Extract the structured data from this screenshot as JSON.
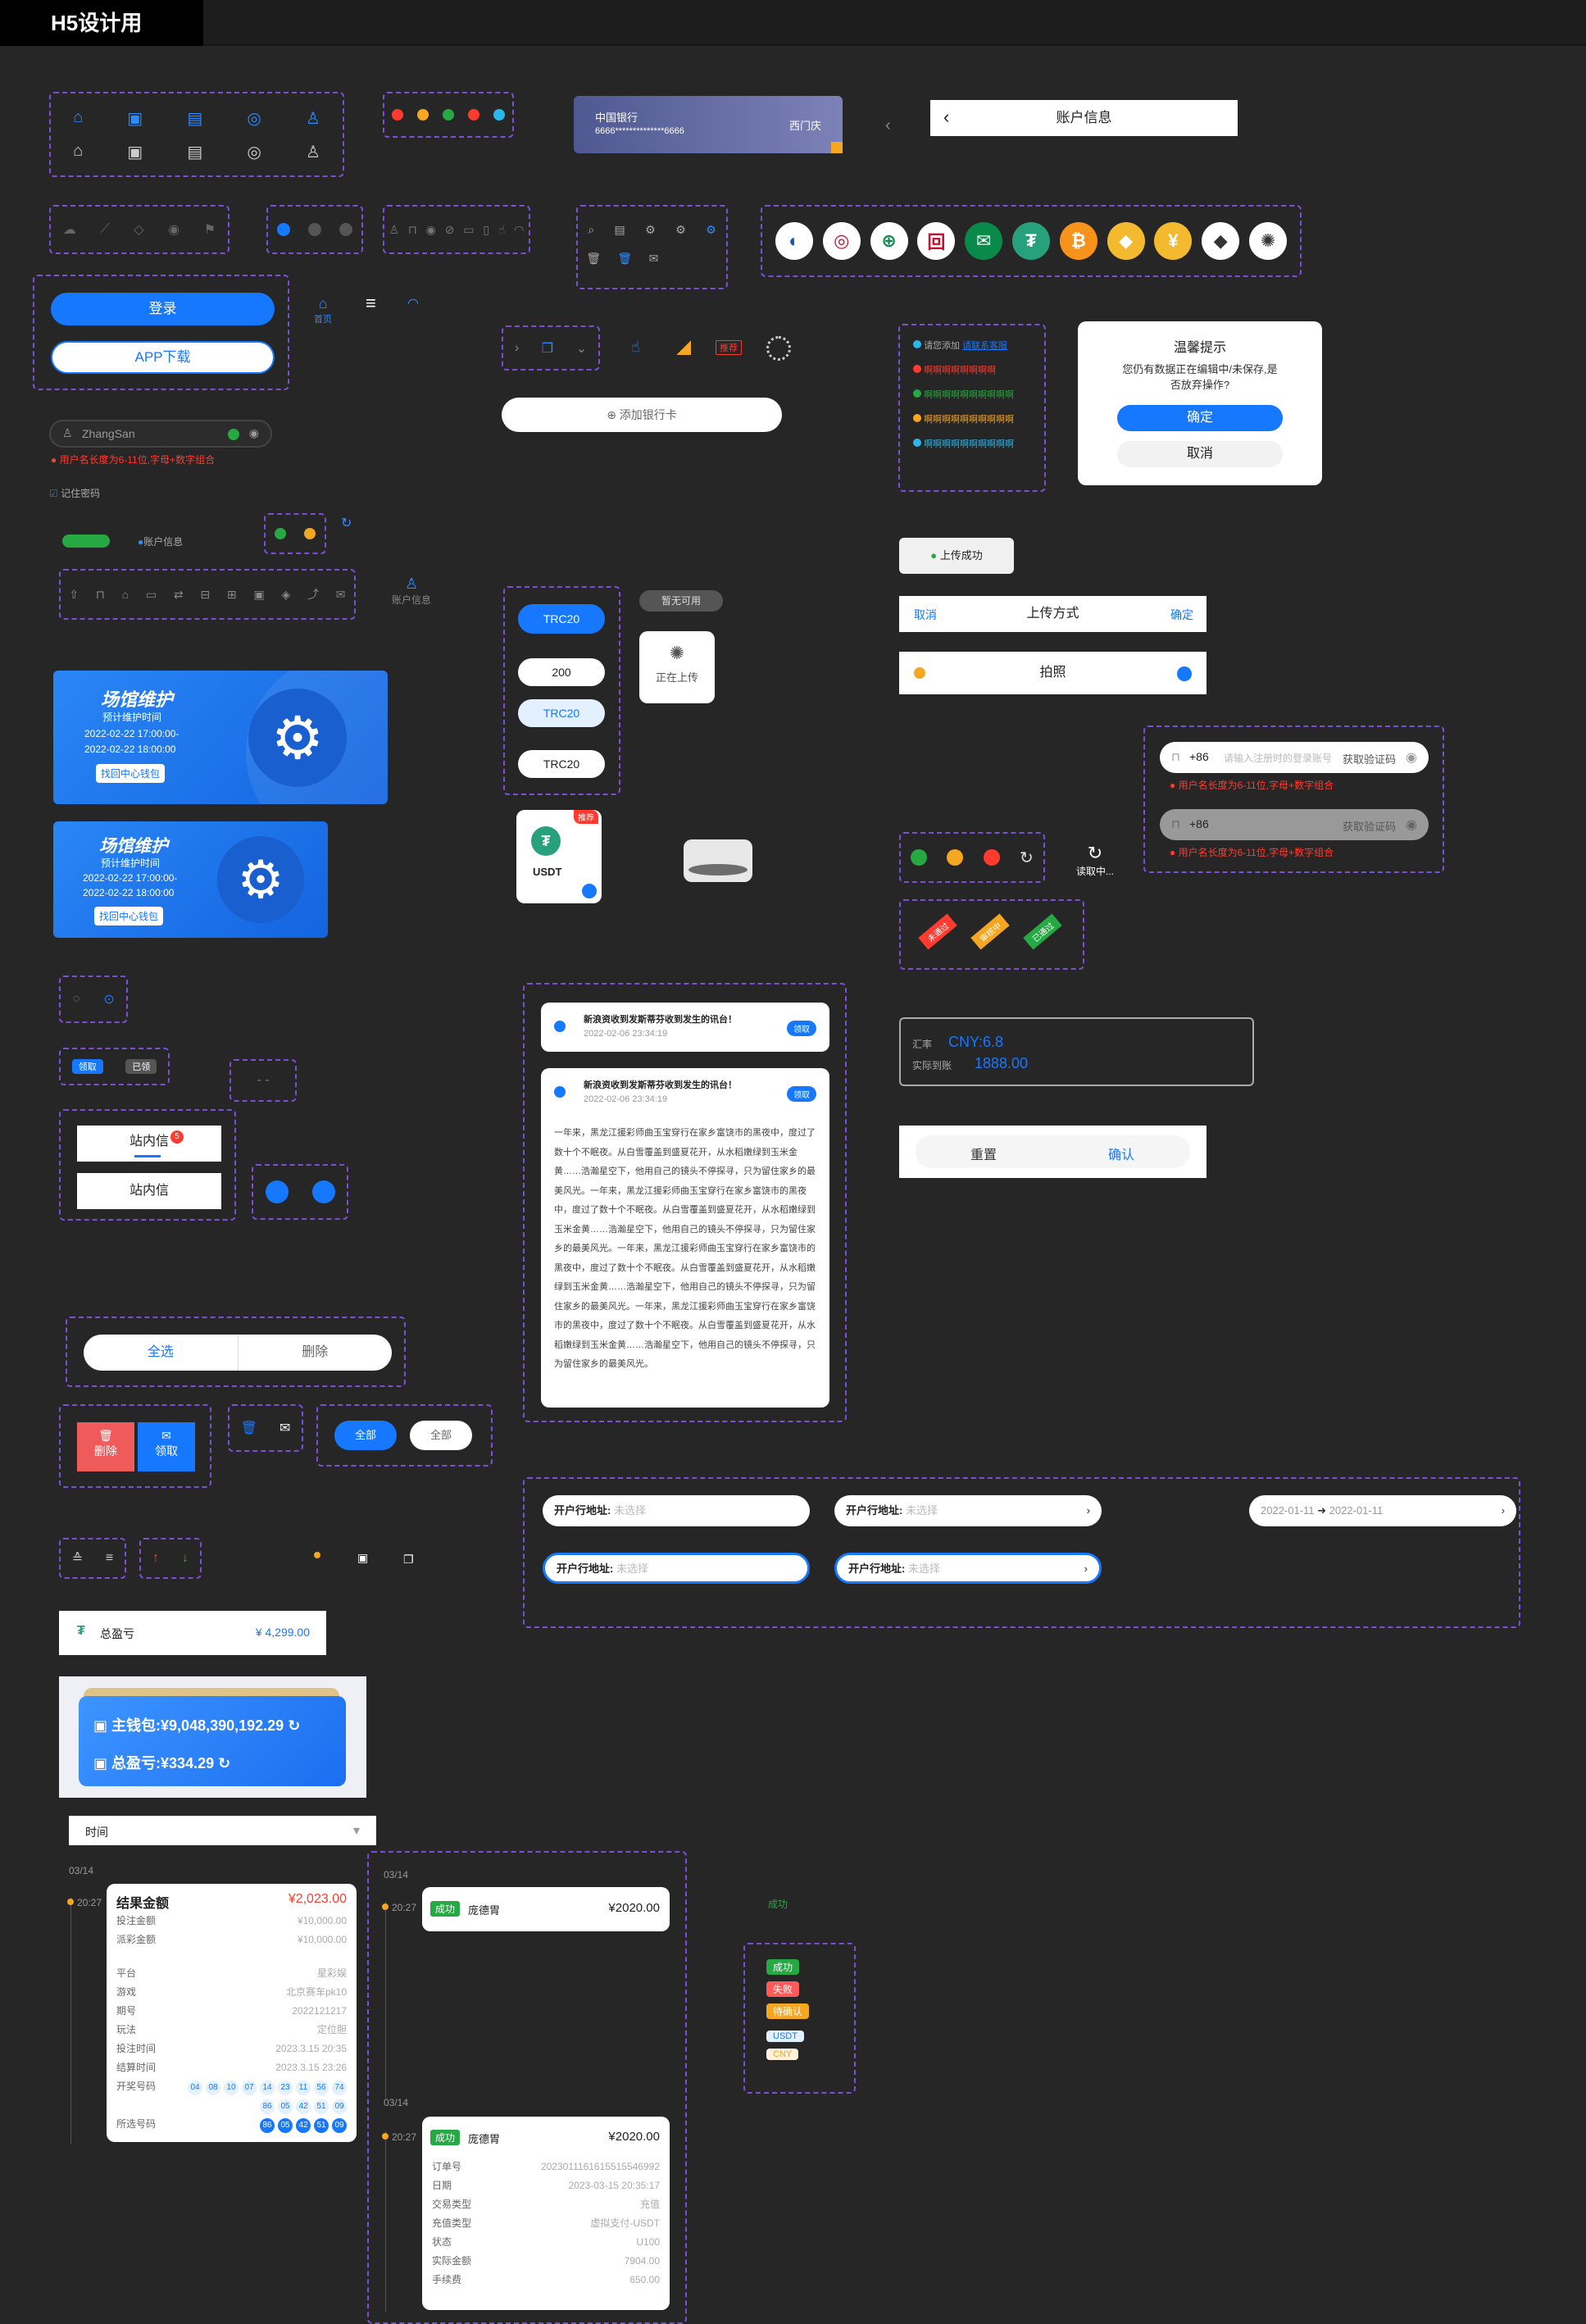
{
  "header": {
    "title": "H5设计用"
  },
  "bank_card": {
    "bank": "中国银行",
    "number": "6666**************6666",
    "holder": "西门庆"
  },
  "nav": {
    "title": "账户信息"
  },
  "login": {
    "login_label": "登录",
    "download_label": "APP下载",
    "home_label": "首页",
    "username": "ZhangSan",
    "error": "用户名长度为6-11位,字母+数字组合",
    "remember": "记住密码"
  },
  "account_info": {
    "label": "账户信息"
  },
  "chips": {
    "trc_selected": "TRC20",
    "amount": "200",
    "trc_light": "TRC20",
    "trc_plain": "TRC20",
    "unavailable": "暂无可用",
    "uploading": "正在上传"
  },
  "add_bank": {
    "label": "添加银行卡"
  },
  "recommend": "推荐",
  "usdt": {
    "label": "USDT",
    "badge": "推荐"
  },
  "notice_list": {
    "first_prefix": "请您添加",
    "first_link": "请联系客服",
    "items": [
      "啊啊啊啊啊啊啊啊",
      "啊啊啊啊啊啊啊啊啊啊",
      "啊啊啊啊啊啊啊啊啊啊",
      "啊啊啊啊啊啊啊啊啊啊"
    ]
  },
  "dialog": {
    "title": "温馨提示",
    "message": "您仍有数据正在编辑中/未保存,是否放弃操作?",
    "confirm": "确定",
    "cancel": "取消"
  },
  "upload_success": "上传成功",
  "upload_method": {
    "cancel": "取消",
    "title": "上传方式",
    "confirm": "确定",
    "option": "拍照"
  },
  "phone_form": {
    "code": "+86",
    "placeholder": "请输入注册时的登录账号",
    "get_code": "获取验证码",
    "error": "用户名长度为6-11位,字母+数字组合"
  },
  "reading": "读取中...",
  "ribbons": [
    "未通过",
    "审核中",
    "已通过"
  ],
  "rate": {
    "label1": "汇率",
    "value1": "CNY:6.8",
    "label2": "实际到账",
    "value2": "1888.00"
  },
  "reset_confirm": {
    "reset": "重置",
    "confirm": "确认"
  },
  "maintenance": {
    "title": "场馆维护",
    "sub": "预计维护时间",
    "from": "2022-02-22 17:00:00-",
    "to": "2022-02-22 18:00:00",
    "button": "找回中心钱包"
  },
  "claim_tags": {
    "claim": "领取",
    "claimed": "已领"
  },
  "mail": {
    "label": "站内信",
    "badge": "5"
  },
  "messages": {
    "title": "新浪资收到发斯蒂芬收到发生的讯台！",
    "time": "2022-02-06  23:34:19",
    "claim": "领取",
    "body": "一年来，黑龙江援彩师曲玉宝穿行在家乡富饶市的黑夜中，度过了数十个不眠夜。从白雪覆盖到盛夏花开，从水稻嫩绿到玉米金黄……浩瀚星空下，他用自己的镜头不停探寻，只为留住家乡的最美风光。一年来，黑龙江援彩师曲玉宝穿行在家乡富饶市的黑夜中，度过了数十个不眠夜。从白雪覆盖到盛夏花开，从水稻嫩绿到玉米金黄……浩瀚星空下，他用自己的镜头不停探寻，只为留住家乡的最美风光。一年来，黑龙江援彩师曲玉宝穿行在家乡富饶市的黑夜中，度过了数十个不眠夜。从白雪覆盖到盛夏花开，从水稻嫩绿到玉米金黄……浩瀚星空下，他用自己的镜头不停探寻，只为留住家乡的最美风光。一年来，黑龙江援彩师曲玉宝穿行在家乡富饶市的黑夜中，度过了数十个不眠夜。从白雪覆盖到盛夏花开，从水稻嫩绿到玉米金黄……浩瀚星空下，他用自己的镜头不停探寻，只为留住家乡的最美风光。"
  },
  "select_delete": {
    "select_all": "全选",
    "delete": "删除"
  },
  "actions": {
    "delete": "删除",
    "claim": "领取",
    "all1": "全部",
    "all2": "全部"
  },
  "address": {
    "label": "开户行地址:",
    "placeholder": "未选择",
    "date_from": "2022-01-11",
    "date_to": "2022-01-11"
  },
  "profit": {
    "label": "总盈亏",
    "value": "¥ 4,299.00"
  },
  "wallet": {
    "main_label": "主钱包:",
    "main_value": "¥9,048,390,192.29",
    "profit_label": "总盈亏:",
    "profit_value": "¥334.29"
  },
  "time_filter": {
    "label": "时间"
  },
  "bet_record": {
    "date": "03/14",
    "time": "20:27",
    "title": "结果金额",
    "amount": "¥2,023.00",
    "rows": [
      [
        "投注金额",
        "¥10,000.00"
      ],
      [
        "派彩金额",
        "¥10,000.00"
      ]
    ],
    "details": [
      [
        "平台",
        "星彩娱"
      ],
      [
        "游戏",
        "北京赛车pk10"
      ],
      [
        "期号",
        "2022121217"
      ],
      [
        "玩法",
        "定位胆"
      ],
      [
        "投注时间",
        "2023.3.15 20:35"
      ],
      [
        "结算时间",
        "2023.3.15 23:26"
      ]
    ],
    "open_label": "开奖号码",
    "open_nums1": [
      "04",
      "08",
      "10",
      "07",
      "14",
      "23",
      "11",
      "56",
      "74"
    ],
    "open_nums2": [
      "86",
      "05",
      "42",
      "51",
      "09"
    ],
    "pick_label": "所选号码",
    "pick_nums": [
      "86",
      "05",
      "42",
      "51",
      "09"
    ]
  },
  "txn": {
    "date": "03/14",
    "time": "20:27",
    "status": "成功",
    "name": "庞德胃",
    "amount": "¥2020.00",
    "date2": "03/14",
    "time2": "20:27",
    "status2": "成功",
    "name2": "庞德胃",
    "amount2": "¥2020.00",
    "details": [
      [
        "订单号",
        "2023011161615515546992"
      ],
      [
        "日期",
        "2023-03-15 20:35:17"
      ],
      [
        "交易类型",
        "充值"
      ],
      [
        "充值类型",
        "虚拟支付-USDT"
      ],
      [
        "状态",
        "U100"
      ],
      [
        "实际金额",
        "7904.00"
      ],
      [
        "手续费",
        "650.00"
      ]
    ]
  },
  "status_tags": {
    "success_text": "成功",
    "success": "成功",
    "fail": "失败",
    "pending": "待确认",
    "usdt": "USDT",
    "cny": "CNY"
  },
  "colors": {
    "accent": "#1677ff",
    "bg": "#262626",
    "dashed": "#7b4fd6",
    "success": "#26a843",
    "danger": "#ff3b30",
    "warning": "#f5a623"
  }
}
